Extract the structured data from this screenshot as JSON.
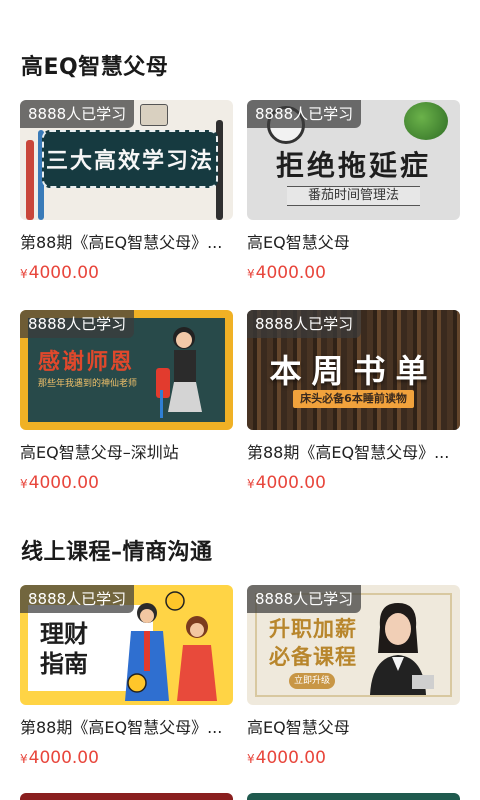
{
  "sections": [
    {
      "title": "高EQ智慧父母",
      "cards": [
        {
          "badge": "8888人已学习",
          "title": "第88期《高EQ智慧父母》...",
          "price_currency": "¥",
          "price": "4000.00",
          "thumb_text": "三大高效学习法",
          "thumb_sub": ""
        },
        {
          "badge": "8888人已学习",
          "title": "高EQ智慧父母",
          "price_currency": "¥",
          "price": "4000.00",
          "thumb_text": "拒绝拖延症",
          "thumb_sub": "番茄时间管理法"
        },
        {
          "badge": "8888人已学习",
          "title": "高EQ智慧父母–深圳站",
          "price_currency": "¥",
          "price": "4000.00",
          "thumb_text": "感谢师恩",
          "thumb_sub": "那些年我遇到的神仙老师"
        },
        {
          "badge": "8888人已学习",
          "title": "第88期《高EQ智慧父母》...",
          "price_currency": "¥",
          "price": "4000.00",
          "thumb_text": "本周书单",
          "thumb_sub": "床头必备6本睡前读物"
        }
      ]
    },
    {
      "title": "线上课程–情商沟通",
      "cards": [
        {
          "badge": "8888人已学习",
          "title": "第88期《高EQ智慧父母》...",
          "price_currency": "¥",
          "price": "4000.00",
          "thumb_text": "理财指南",
          "thumb_sub": ""
        },
        {
          "badge": "8888人已学习",
          "title": "高EQ智慧父母",
          "price_currency": "¥",
          "price": "4000.00",
          "thumb_text": "升职加薪必备课程",
          "thumb_sub": "立即升级"
        }
      ]
    }
  ],
  "colors": {
    "price": "#e8463c",
    "badge_bg": "#3c3c3c"
  }
}
